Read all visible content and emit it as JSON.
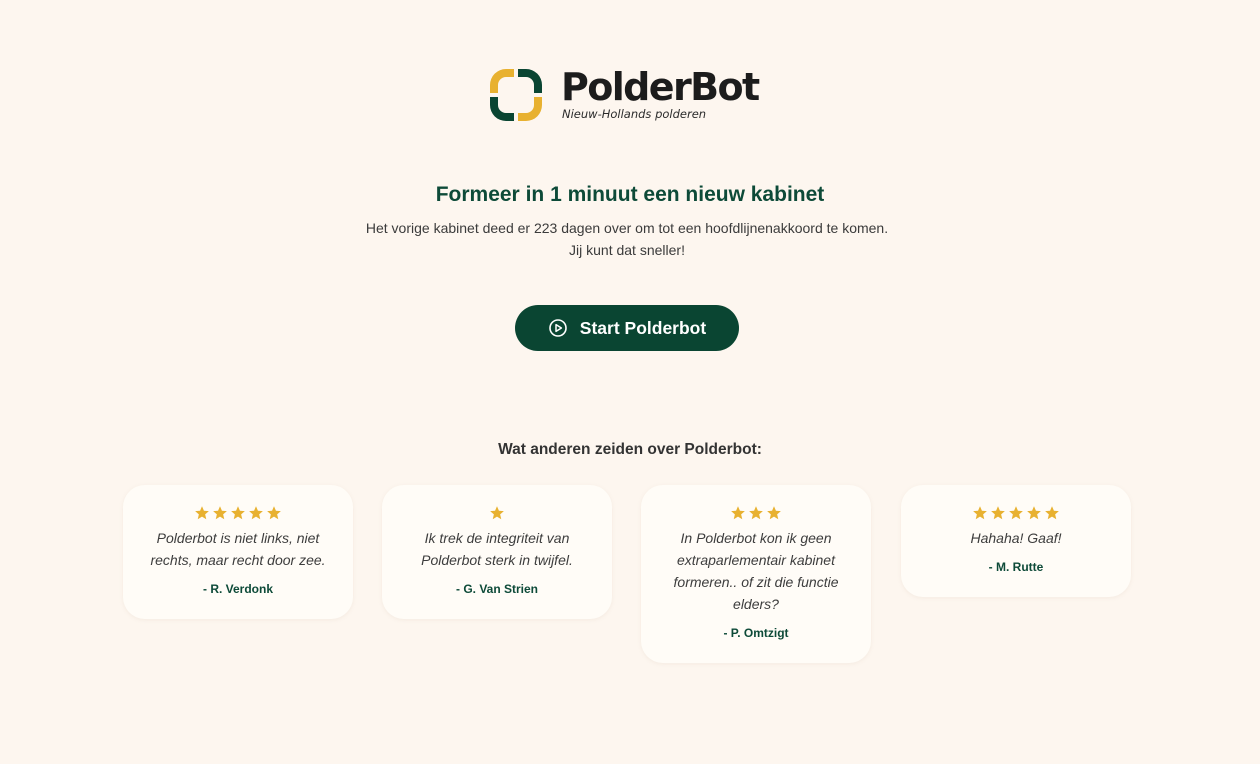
{
  "brand": {
    "name": "PolderBot",
    "tagline": "Nieuw-Hollands polderen"
  },
  "colors": {
    "background": "#fdf6ef",
    "primary_green": "#0a4532",
    "accent_yellow": "#e8b130",
    "card": "#fffcf7"
  },
  "hero": {
    "title": "Formeer in 1 minuut een nieuw kabinet",
    "subtitle": "Het vorige kabinet deed er 223 dagen over om tot een hoofdlijnenakkoord te komen. Jij kunt dat sneller!",
    "button_label": "Start Polderbot",
    "button_icon": "play-circle-icon"
  },
  "reviews": {
    "heading": "Wat anderen zeiden over Polderbot:",
    "items": [
      {
        "rating": 5,
        "quote": "Polderbot is niet links, niet rechts, maar recht door zee.",
        "author": "- R. Verdonk"
      },
      {
        "rating": 1,
        "quote": "Ik trek de integriteit van Polderbot sterk in twijfel.",
        "author": "- G. Van Strien"
      },
      {
        "rating": 3,
        "quote": "In Polderbot kon ik geen extraparlementair kabinet formeren.. of zit die functie elders?",
        "author": "- P. Omtzigt"
      },
      {
        "rating": 5,
        "quote": "Hahaha! Gaaf!",
        "author": "- M. Rutte"
      }
    ]
  }
}
